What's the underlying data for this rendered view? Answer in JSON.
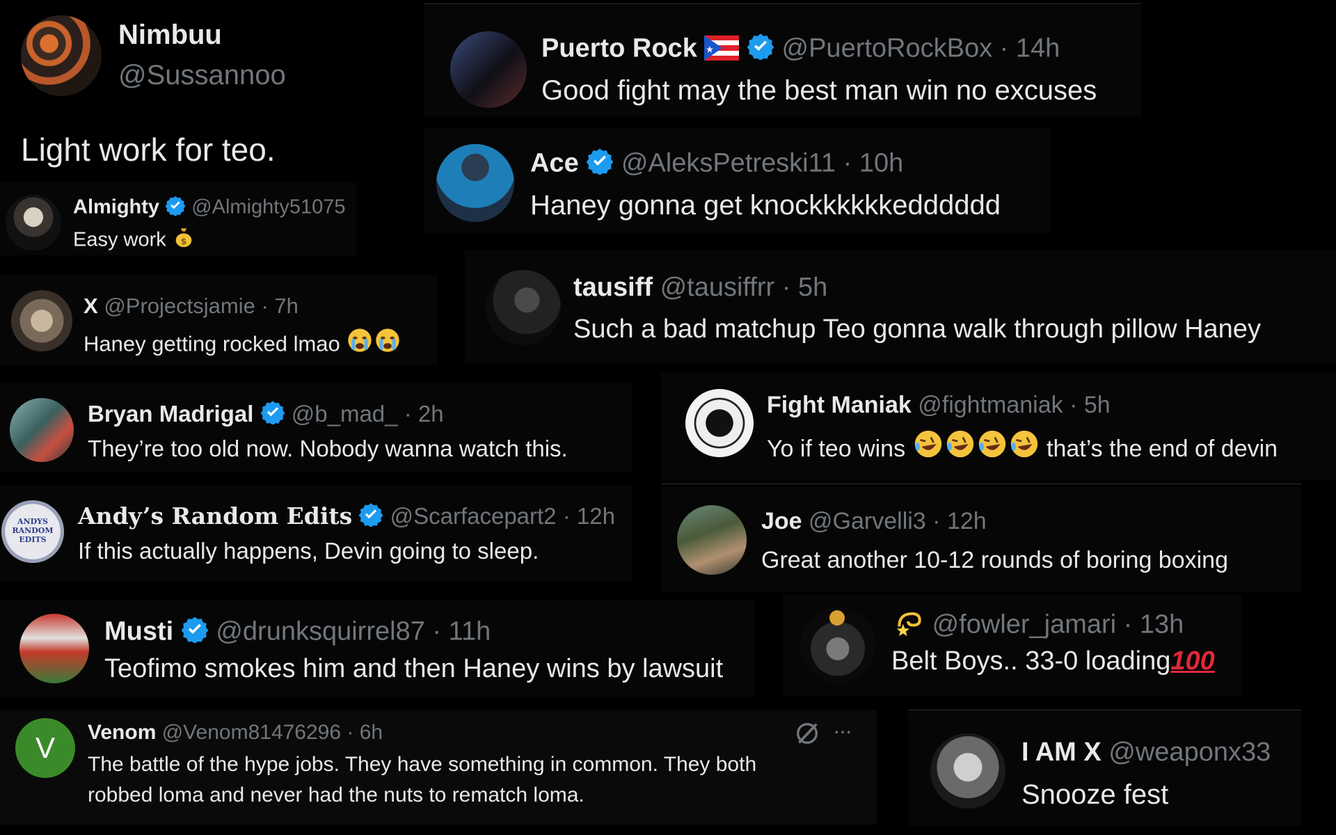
{
  "tweets": [
    {
      "name": "Nimbuu",
      "handle": "@Sussannoo",
      "time": "",
      "text": "Light work for teo."
    },
    {
      "name": "Puerto Rock",
      "handle": "@PuertoRockBox",
      "sep": "·",
      "time": "14h",
      "text": "Good fight may the best man win no excuses"
    },
    {
      "name": "Ace",
      "handle": "@AleksPetreski11",
      "sep": "·",
      "time": "10h",
      "text": "Haney gonna get knockkkkkkedddddd"
    },
    {
      "name": "Almighty",
      "handle": "@Almighty51075",
      "time": "",
      "text": "Easy work"
    },
    {
      "name": "X",
      "handle": "@Projectsjamie",
      "sep": "·",
      "time": "7h",
      "text": "Haney getting rocked lmao"
    },
    {
      "name": "tausiff",
      "handle": "@tausiffrr",
      "sep": "·",
      "time": "5h",
      "text": "Such a bad matchup Teo gonna walk through pillow Haney"
    },
    {
      "name": "Bryan Madrigal",
      "handle": "@b_mad_",
      "sep": "·",
      "time": "2h",
      "text": "They’re too old now. Nobody wanna watch this."
    },
    {
      "name": "Fight Maniak",
      "handle": "@fightmaniak",
      "sep": "·",
      "time": "5h",
      "text_before": "Yo if teo wins",
      "text_after": "that’s the end of devin"
    },
    {
      "name": "Andy’s Random Edits",
      "handle": "@Scarfacepart2",
      "sep": "·",
      "time": "12h",
      "text": "If this actually happens, Devin going to sleep.",
      "avatar_text": "ANDYS RANDOM EDITS"
    },
    {
      "name": "Joe",
      "handle": "@Garvelli3",
      "sep": "·",
      "time": "12h",
      "text": "Great another 10-12 rounds of boring boxing"
    },
    {
      "name": "Musti",
      "handle": "@drunksquirrel87",
      "sep": "·",
      "time": "11h",
      "text": "Teofimo smokes him and then Haney wins by lawsuit"
    },
    {
      "name": "",
      "handle": "@fowler_jamari",
      "sep": "·",
      "time": "13h",
      "text": "Belt Boys.. 33-0 loading",
      "hundred": "100"
    },
    {
      "name": "Venom",
      "handle": "@Venom81476296",
      "sep": "·",
      "time": "6h",
      "text_line1": "The battle of the hype jobs. They have something in common. They both",
      "text_line2": "robbed loma and never had the nuts to rematch loma.",
      "avatar_letter": "V",
      "more": "···"
    },
    {
      "name": "I AM X",
      "handle": "@weaponx33",
      "time": "",
      "text": "Snooze fest"
    }
  ],
  "colors": {
    "verified": "#1d9bf0",
    "handle": "#71767b",
    "text": "#e7e9ea",
    "venom_avatar": "#3b8a2a"
  }
}
